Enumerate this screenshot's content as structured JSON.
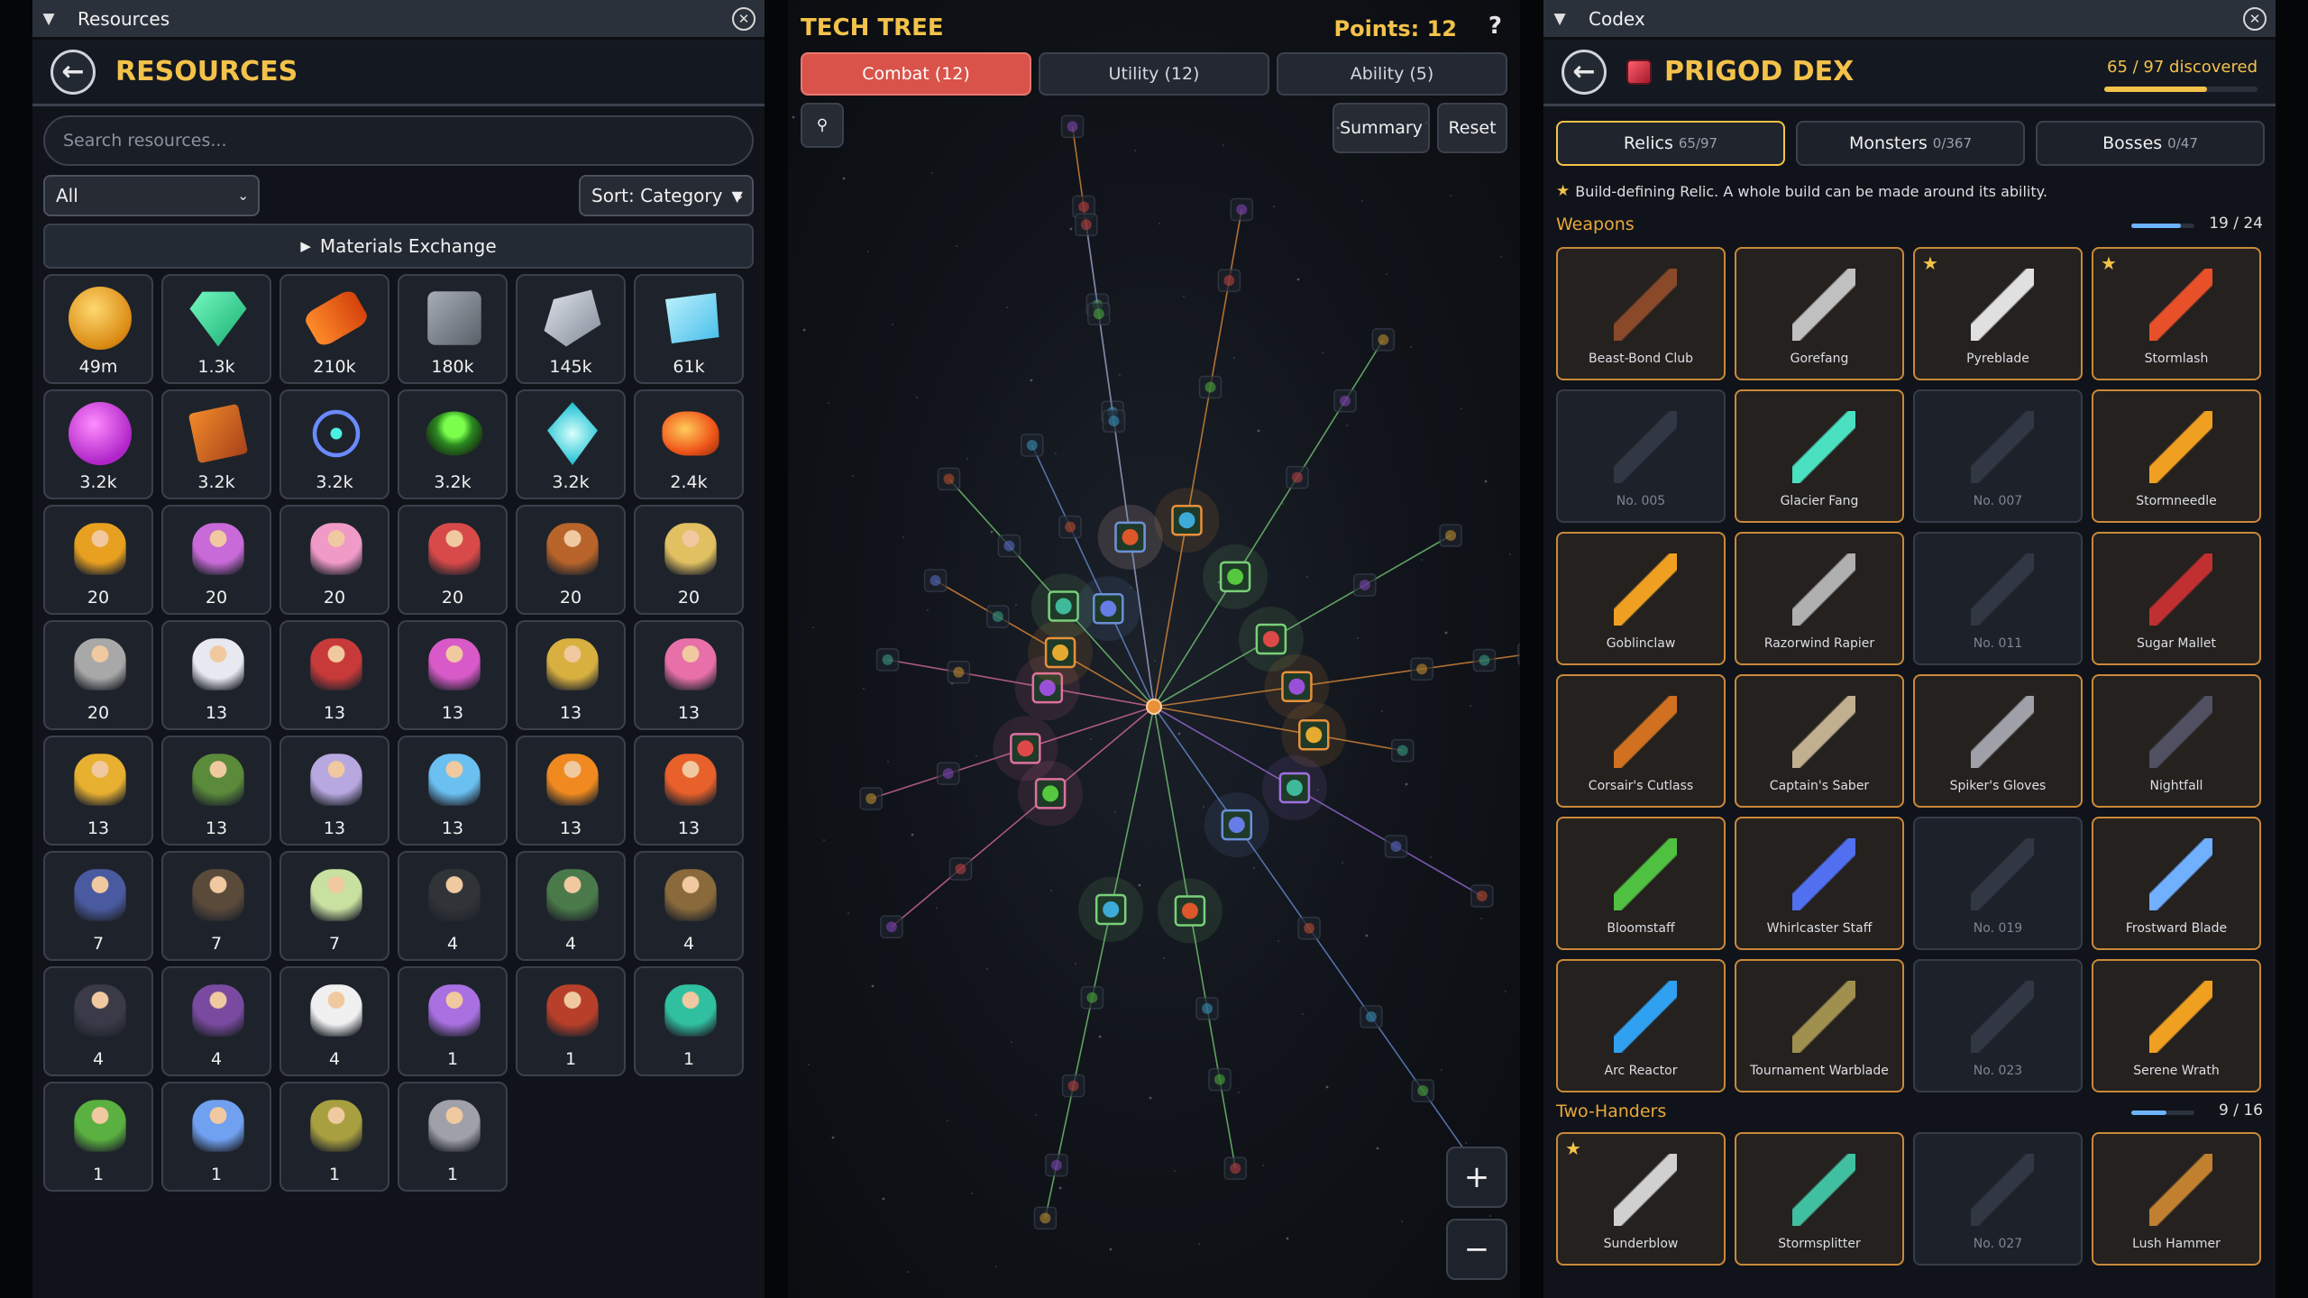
{
  "resources_panel": {
    "window_title": "Resources",
    "title": "RESOURCES",
    "search_placeholder": "Search resources...",
    "filter_value": "All",
    "sort_label": "Sort: Category",
    "exchange_label": "Materials Exchange",
    "items": [
      {
        "icon": "gold-coins-icon",
        "count": "49m"
      },
      {
        "icon": "emerald-gem-icon",
        "count": "1.3k"
      },
      {
        "icon": "wood-log-icon",
        "count": "210k"
      },
      {
        "icon": "stone-block-icon",
        "count": "180k"
      },
      {
        "icon": "iron-ingot-icon",
        "count": "145k"
      },
      {
        "icon": "ice-crystal-icon",
        "count": "61k"
      },
      {
        "icon": "magic-orb-icon",
        "count": "3.2k"
      },
      {
        "icon": "spell-book-icon",
        "count": "3.2k"
      },
      {
        "icon": "arcane-symbol-icon",
        "count": "3.2k"
      },
      {
        "icon": "potion-cauldron-icon",
        "count": "3.2k"
      },
      {
        "icon": "frost-shard-icon",
        "count": "3.2k"
      },
      {
        "icon": "fire-ore-icon",
        "count": "2.4k"
      },
      {
        "icon": "hero-portrait-icon",
        "count": "20"
      },
      {
        "icon": "hero-portrait-icon",
        "count": "20"
      },
      {
        "icon": "hero-portrait-icon",
        "count": "20"
      },
      {
        "icon": "hero-portrait-icon",
        "count": "20"
      },
      {
        "icon": "hero-portrait-icon",
        "count": "20"
      },
      {
        "icon": "hero-portrait-icon",
        "count": "20"
      },
      {
        "icon": "hero-portrait-icon",
        "count": "20"
      },
      {
        "icon": "hero-portrait-icon",
        "count": "13"
      },
      {
        "icon": "hero-portrait-icon",
        "count": "13"
      },
      {
        "icon": "hero-portrait-icon",
        "count": "13"
      },
      {
        "icon": "hero-portrait-icon",
        "count": "13"
      },
      {
        "icon": "hero-portrait-icon",
        "count": "13"
      },
      {
        "icon": "hero-portrait-icon",
        "count": "13"
      },
      {
        "icon": "hero-portrait-icon",
        "count": "13"
      },
      {
        "icon": "hero-portrait-icon",
        "count": "13"
      },
      {
        "icon": "hero-portrait-icon",
        "count": "13"
      },
      {
        "icon": "hero-portrait-icon",
        "count": "13"
      },
      {
        "icon": "hero-portrait-icon",
        "count": "13"
      },
      {
        "icon": "hero-portrait-icon",
        "count": "7"
      },
      {
        "icon": "hero-portrait-icon",
        "count": "7"
      },
      {
        "icon": "hero-portrait-icon",
        "count": "7"
      },
      {
        "icon": "hero-portrait-icon",
        "count": "4"
      },
      {
        "icon": "hero-portrait-icon",
        "count": "4"
      },
      {
        "icon": "hero-portrait-icon",
        "count": "4"
      },
      {
        "icon": "hero-portrait-icon",
        "count": "4"
      },
      {
        "icon": "hero-portrait-icon",
        "count": "4"
      },
      {
        "icon": "hero-portrait-icon",
        "count": "4"
      },
      {
        "icon": "hero-portrait-icon",
        "count": "1"
      },
      {
        "icon": "hero-portrait-icon",
        "count": "1"
      },
      {
        "icon": "hero-portrait-icon",
        "count": "1"
      },
      {
        "icon": "hero-portrait-icon",
        "count": "1"
      },
      {
        "icon": "hero-portrait-icon",
        "count": "1"
      },
      {
        "icon": "hero-portrait-icon",
        "count": "1"
      },
      {
        "icon": "hero-portrait-icon",
        "count": "1"
      }
    ],
    "hero_colors": [
      "#e8a020",
      "#c86ad8",
      "#f09ac8",
      "#d84a4a",
      "#b8642a",
      "#e0c060",
      "#a8a8a8",
      "#e8e8f0",
      "#c83a3a",
      "#d85ac8",
      "#d8b040",
      "#e870a8",
      "#e8b030",
      "#5a8a3a",
      "#b8a8e0",
      "#6ac0f0",
      "#f08a20",
      "#e8602a",
      "#4a5aa0",
      "#5a4a3a",
      "#c8e0a0",
      "#303438",
      "#4a7a4a",
      "#8a6a3a",
      "#3a3a48",
      "#7a4aa0",
      "#f0f0f0",
      "#a870e0",
      "#b8402a",
      "#30c0a0",
      "#5ab040",
      "#70a0f0",
      "#a8a040",
      "#a0a0a8"
    ]
  },
  "tech_panel": {
    "title": "TECH TREE",
    "points_label": "Points: 12",
    "help_label": "?",
    "tabs": [
      {
        "label": "Combat (12)",
        "active": true
      },
      {
        "label": "Utility (12)",
        "active": false
      },
      {
        "label": "Ability (5)",
        "active": false
      }
    ],
    "pin_icon": "pin-icon",
    "summary_label": "Summary",
    "reset_label": "Reset",
    "zoom_in_label": "+",
    "zoom_out_label": "−",
    "colors": {
      "line_orange": "#e8903a",
      "line_green": "#7ad07a",
      "line_pink": "#e070a0",
      "line_blue": "#6a90d8",
      "line_purple": "#a070e0"
    }
  },
  "codex_panel": {
    "window_title": "Codex",
    "title": "PRIGOD DEX",
    "discovered_label": "65 / 97 discovered",
    "discovered_progress": 0.67,
    "tabs": [
      {
        "label": "Relics",
        "count": "65/97",
        "active": true
      },
      {
        "label": "Monsters",
        "count": "0/367",
        "active": false
      },
      {
        "label": "Bosses",
        "count": "0/47",
        "active": false
      }
    ],
    "note": "Build-defining Relic. A whole build can be made around its ability.",
    "sections": [
      {
        "title": "Weapons",
        "count": "19 / 24",
        "progress": 0.79
      },
      {
        "title": "Two-Handers",
        "count": "9 / 16",
        "progress": 0.56
      }
    ],
    "weapons": [
      {
        "name": "Beast-Bond Club",
        "star": false,
        "locked": false,
        "color": "#8a4a2a"
      },
      {
        "name": "Gorefang",
        "star": false,
        "locked": false,
        "color": "#c0c0c0"
      },
      {
        "name": "Pyreblade",
        "star": true,
        "locked": false,
        "color": "#e0e0e0"
      },
      {
        "name": "Stormlash",
        "star": true,
        "locked": false,
        "color": "#e8502a"
      },
      {
        "name": "No. 005",
        "star": false,
        "locked": true,
        "color": "#3a4150"
      },
      {
        "name": "Glacier Fang",
        "star": false,
        "locked": false,
        "color": "#4ae0c0"
      },
      {
        "name": "No. 007",
        "star": false,
        "locked": true,
        "color": "#3a4150"
      },
      {
        "name": "Stormneedle",
        "star": false,
        "locked": false,
        "color": "#f0a020"
      },
      {
        "name": "Goblinclaw",
        "star": false,
        "locked": false,
        "color": "#f0a020"
      },
      {
        "name": "Razorwind Rapier",
        "star": false,
        "locked": false,
        "color": "#b0b0b0"
      },
      {
        "name": "No. 011",
        "star": false,
        "locked": true,
        "color": "#3a4150"
      },
      {
        "name": "Sugar Mallet",
        "star": false,
        "locked": false,
        "color": "#c03030"
      },
      {
        "name": "Corsair's Cutlass",
        "star": false,
        "locked": false,
        "color": "#d07020"
      },
      {
        "name": "Captain's Saber",
        "star": false,
        "locked": false,
        "color": "#c0b090"
      },
      {
        "name": "Spiker's Gloves",
        "star": false,
        "locked": false,
        "color": "#a0a0a8"
      },
      {
        "name": "Nightfall",
        "star": false,
        "locked": false,
        "color": "#505060"
      },
      {
        "name": "Bloomstaff",
        "star": false,
        "locked": false,
        "color": "#50c040"
      },
      {
        "name": "Whirlcaster Staff",
        "star": false,
        "locked": false,
        "color": "#5070f0"
      },
      {
        "name": "No. 019",
        "star": false,
        "locked": true,
        "color": "#3a4150"
      },
      {
        "name": "Frostward Blade",
        "star": false,
        "locked": false,
        "color": "#70b0ff"
      },
      {
        "name": "Arc Reactor",
        "star": false,
        "locked": false,
        "color": "#30a0f0"
      },
      {
        "name": "Tournament Warblade",
        "star": false,
        "locked": false,
        "color": "#a09050"
      },
      {
        "name": "No. 023",
        "star": false,
        "locked": true,
        "color": "#3a4150"
      },
      {
        "name": "Serene Wrath",
        "star": false,
        "locked": false,
        "color": "#f0a020"
      }
    ],
    "two_handers": [
      {
        "name": "Sunderblow",
        "star": true,
        "locked": false,
        "color": "#d0d0d0"
      },
      {
        "name": "Stormsplitter",
        "star": false,
        "locked": false,
        "color": "#40c0a0"
      },
      {
        "name": "No. 027",
        "star": false,
        "locked": true,
        "color": "#3a4150"
      },
      {
        "name": "Lush Hammer",
        "star": false,
        "locked": false,
        "color": "#c08030"
      }
    ]
  }
}
